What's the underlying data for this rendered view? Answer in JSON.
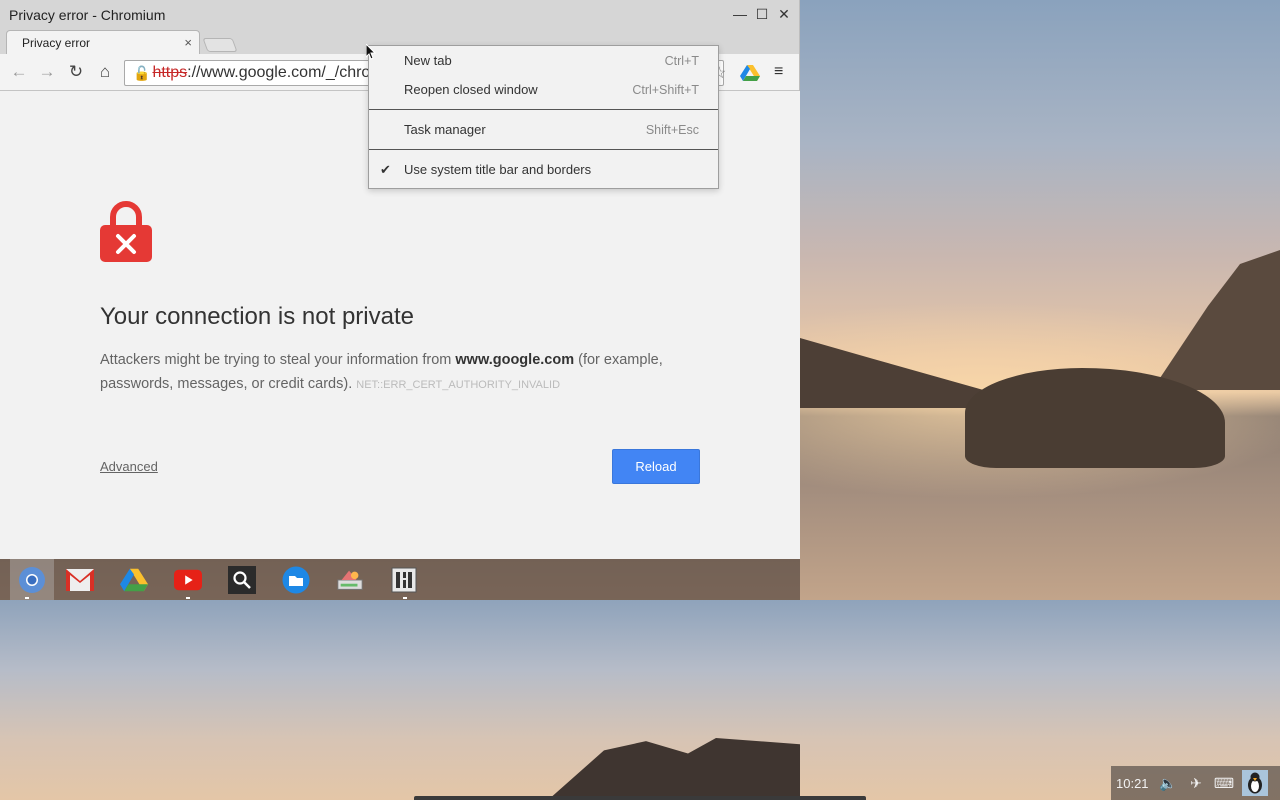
{
  "window": {
    "title": "Privacy error - Chromium",
    "controls": {
      "minimize": "—",
      "maximize": "☐",
      "close": "✕"
    }
  },
  "tab": {
    "label": "Privacy error",
    "close": "×"
  },
  "toolbar": {
    "back_icon": "←",
    "forward_icon": "→",
    "reload_icon": "↻",
    "home_icon": "⌂",
    "omnibox": {
      "scheme": "https",
      "rest": "://www.google.com/_/chrome"
    },
    "star_icon": "☆",
    "menu_icon": "≡"
  },
  "error_page": {
    "heading": "Your connection is not private",
    "desc_before": "Attackers might be trying to steal your information from ",
    "host": "www.google.com",
    "desc_after": " (for example, passwords, messages, or credit cards).",
    "error_code": "NET::ERR_CERT_AUTHORITY_INVALID",
    "advanced": "Advanced",
    "reload": "Reload",
    "lock_color": "#e53935"
  },
  "context_menu": {
    "new_tab": {
      "label": "New tab",
      "shortcut": "Ctrl+T"
    },
    "reopen": {
      "label": "Reopen closed window",
      "shortcut": "Ctrl+Shift+T"
    },
    "task_manager": {
      "label": "Task manager",
      "shortcut": "Shift+Esc"
    },
    "system_title": {
      "label": "Use system title bar and borders",
      "check": "✔",
      "checked": true
    }
  },
  "shelf": {
    "apps": [
      "chromium-icon",
      "gmail-icon",
      "google-drive-icon",
      "youtube-icon",
      "search-icon",
      "files-icon",
      "paint-icon",
      "terminal-icon"
    ]
  },
  "status": {
    "time": "10:21",
    "volume_icon": "🔈",
    "network_icon": "✈",
    "keyboard_icon": "⌨"
  },
  "colors": {
    "accent": "#4285f4",
    "error_red": "#e53935"
  }
}
